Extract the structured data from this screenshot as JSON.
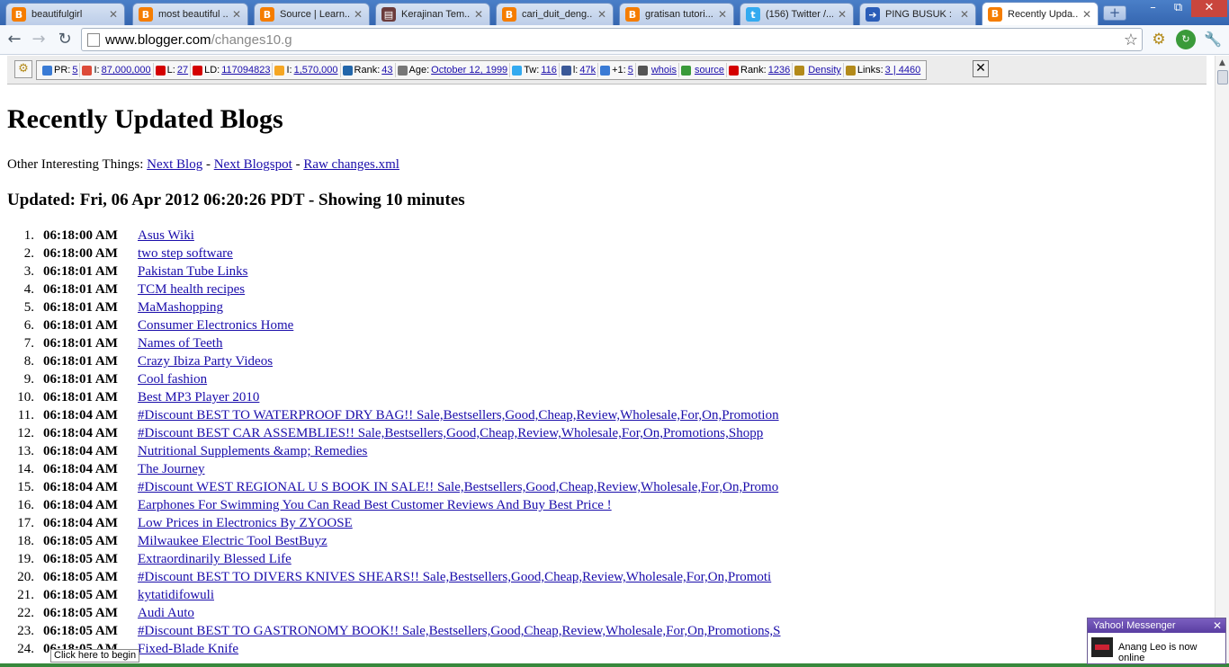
{
  "tabs": [
    {
      "title": "beautifulgirl",
      "icon": "blogger-icon",
      "color": "#f57d00"
    },
    {
      "title": "most beautiful ...",
      "icon": "blogger-icon",
      "color": "#f57d00"
    },
    {
      "title": "Source | Learn...",
      "icon": "blogger-icon",
      "color": "#f57d00"
    },
    {
      "title": "Kerajinan Tem...",
      "icon": "book-icon",
      "color": "#6b3b3b"
    },
    {
      "title": "cari_duit_deng...",
      "icon": "blogger-icon",
      "color": "#f57d00"
    },
    {
      "title": "gratisan tutori...",
      "icon": "blogger-icon",
      "color": "#f57d00"
    },
    {
      "title": "(156) Twitter /...",
      "icon": "twitter-icon",
      "color": "#33aaf0"
    },
    {
      "title": "PING BUSUK : ...",
      "icon": "arrow-icon",
      "color": "#2b5db8"
    },
    {
      "title": "Recently Upda...",
      "icon": "blogger-icon",
      "color": "#f57d00"
    }
  ],
  "window_controls": {
    "minimize": "–",
    "restore": "⧉",
    "close": "✕"
  },
  "address_bar": {
    "host": "www.blogger.com",
    "path": "/changes10.g"
  },
  "seo_bar": [
    {
      "label": "PR:",
      "value": "5",
      "icon": "google-icon",
      "color": "#3a7bd5"
    },
    {
      "label": "I:",
      "value": "87,000,000",
      "icon": "google-index-icon",
      "color": "#dd4b39"
    },
    {
      "label": "L:",
      "value": "27",
      "icon": "yahoo-icon",
      "color": "#d40000"
    },
    {
      "label": "LD:",
      "value": "117094823",
      "icon": "yahoo-ld-icon",
      "color": "#d40000"
    },
    {
      "label": "I:",
      "value": "1,570,000",
      "icon": "bing-icon",
      "color": "#f5a623"
    },
    {
      "label": "Rank:",
      "value": "43",
      "icon": "alexa-icon",
      "color": "#2266aa"
    },
    {
      "label": "Age:",
      "value": "October 12, 1999",
      "icon": "archive-icon",
      "color": "#777777"
    },
    {
      "label": "Tw:",
      "value": "116",
      "icon": "twitter-icon",
      "color": "#33aaf0"
    },
    {
      "label": "l:",
      "value": "47k",
      "icon": "facebook-icon",
      "color": "#3b5998"
    },
    {
      "label": "+1:",
      "value": "5",
      "icon": "google-plus-icon",
      "color": "#3a7bd5"
    },
    {
      "label": "",
      "value": "whois",
      "icon": "whois-icon",
      "color": "#555555"
    },
    {
      "label": "",
      "value": "source",
      "icon": "source-icon",
      "color": "#3a9a3a"
    },
    {
      "label": "Rank:",
      "value": "1236",
      "icon": "compete-icon",
      "color": "#d40000"
    },
    {
      "label": "",
      "value": "Density",
      "icon": "density-gear-icon",
      "color": "#b38a1a"
    },
    {
      "label": "Links:",
      "value": "3 | 4460",
      "icon": "links-gear-icon",
      "color": "#b38a1a"
    }
  ],
  "page": {
    "heading": "Recently Updated Blogs",
    "interesting_prefix": "Other Interesting Things:",
    "links": [
      "Next Blog",
      "Next Blogspot",
      "Raw changes.xml"
    ],
    "separator": "-",
    "updated": "Updated: Fri, 06 Apr 2012 06:20:26 PDT - Showing 10 minutes"
  },
  "blogs": [
    {
      "n": "1.",
      "time": "06:18:00 AM",
      "title": "Asus Wiki"
    },
    {
      "n": "2.",
      "time": "06:18:00 AM",
      "title": "two step software"
    },
    {
      "n": "3.",
      "time": "06:18:01 AM",
      "title": "Pakistan Tube Links"
    },
    {
      "n": "4.",
      "time": "06:18:01 AM",
      "title": "TCM health recipes"
    },
    {
      "n": "5.",
      "time": "06:18:01 AM",
      "title": "MaMashopping"
    },
    {
      "n": "6.",
      "time": "06:18:01 AM",
      "title": "Consumer Electronics Home"
    },
    {
      "n": "7.",
      "time": "06:18:01 AM",
      "title": "Names of Teeth"
    },
    {
      "n": "8.",
      "time": "06:18:01 AM",
      "title": "Crazy Ibiza Party Videos"
    },
    {
      "n": "9.",
      "time": "06:18:01 AM",
      "title": "Cool fashion"
    },
    {
      "n": "10.",
      "time": "06:18:01 AM",
      "title": "Best MP3 Player 2010"
    },
    {
      "n": "11.",
      "time": "06:18:04 AM",
      "title": "#Discount BEST TO WATERPROOF DRY BAG!! Sale,Bestsellers,Good,Cheap,Review,Wholesale,For,On,Promotion"
    },
    {
      "n": "12.",
      "time": "06:18:04 AM",
      "title": "#Discount BEST CAR ASSEMBLIES!! Sale,Bestsellers,Good,Cheap,Review,Wholesale,For,On,Promotions,Shopp"
    },
    {
      "n": "13.",
      "time": "06:18:04 AM",
      "title": "Nutritional Supplements &amp; Remedies"
    },
    {
      "n": "14.",
      "time": "06:18:04 AM",
      "title": "The Journey"
    },
    {
      "n": "15.",
      "time": "06:18:04 AM",
      "title": "#Discount WEST REGIONAL U S BOOK IN SALE!! Sale,Bestsellers,Good,Cheap,Review,Wholesale,For,On,Promo"
    },
    {
      "n": "16.",
      "time": "06:18:04 AM",
      "title": "Earphones For Swimming You Can Read Best Customer Reviews And Buy Best Price !"
    },
    {
      "n": "17.",
      "time": "06:18:04 AM",
      "title": "Low Prices in Electronics By ZYOOSE"
    },
    {
      "n": "18.",
      "time": "06:18:05 AM",
      "title": "Milwaukee Electric Tool BestBuyz"
    },
    {
      "n": "19.",
      "time": "06:18:05 AM",
      "title": "Extraordinarily Blessed Life"
    },
    {
      "n": "20.",
      "time": "06:18:05 AM",
      "title": "#Discount BEST TO DIVERS KNIVES SHEARS!! Sale,Bestsellers,Good,Cheap,Review,Wholesale,For,On,Promoti"
    },
    {
      "n": "21.",
      "time": "06:18:05 AM",
      "title": "kytatidifowuli"
    },
    {
      "n": "22.",
      "time": "06:18:05 AM",
      "title": "Audi Auto"
    },
    {
      "n": "23.",
      "time": "06:18:05 AM",
      "title": "#Discount BEST TO GASTRONOMY BOOK!! Sale,Bestsellers,Good,Cheap,Review,Wholesale,For,On,Promotions,S"
    },
    {
      "n": "24.",
      "time": "06:18:05 AM",
      "title": "Fixed-Blade Knife"
    }
  ],
  "status_bubble": "Click here to begin",
  "messenger": {
    "title": "Yahoo! Messenger",
    "message": "Anang Leo is now online",
    "close": "✕"
  },
  "colors": {
    "tabstrip": "#3566b0",
    "link": "#1a0dab",
    "status_strip": "#37883c"
  }
}
